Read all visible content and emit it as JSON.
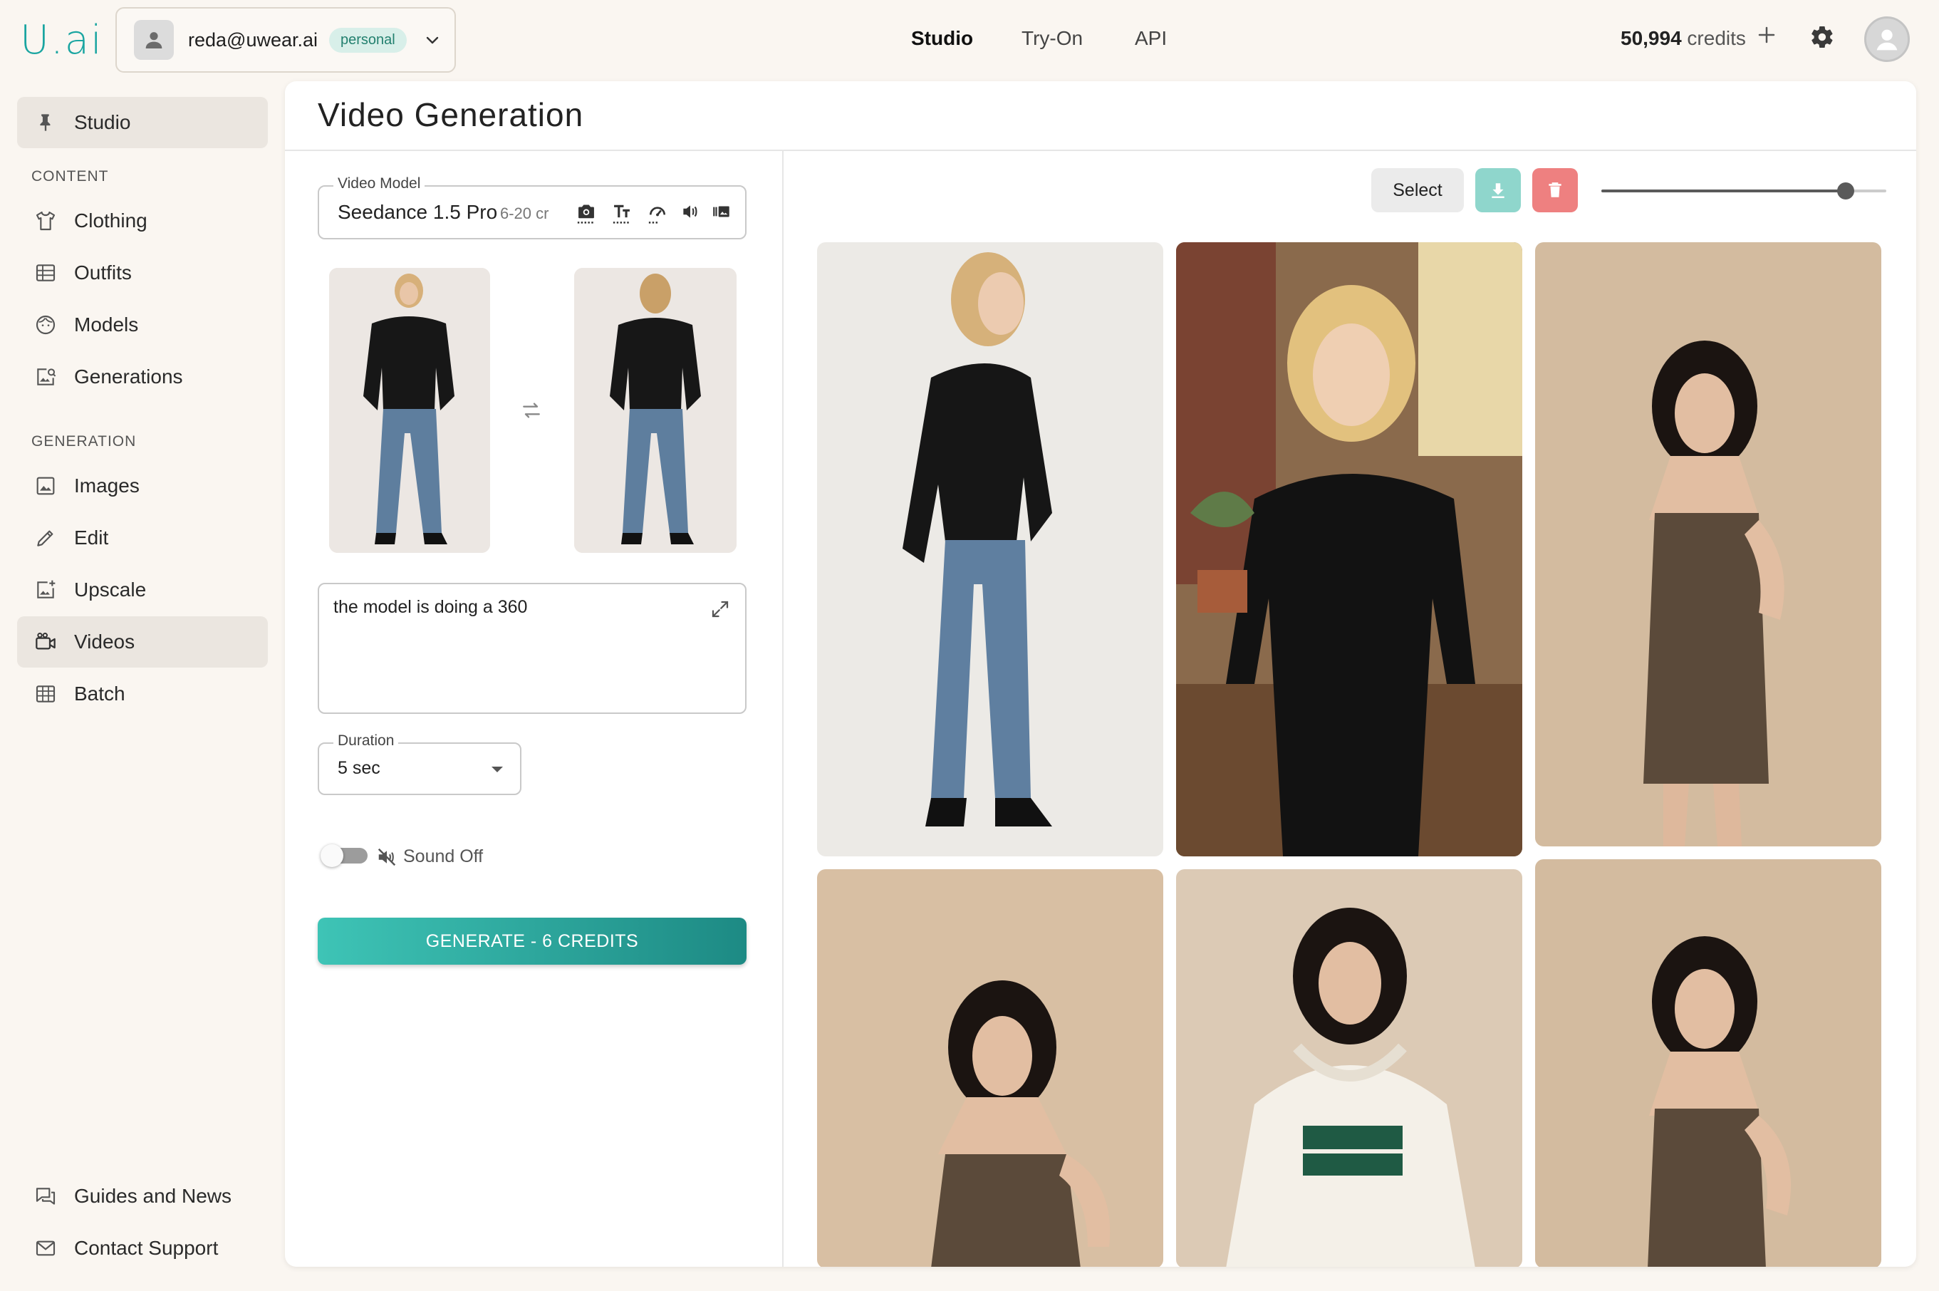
{
  "app": {
    "logo_text": "U.ai",
    "accent": "#1aa5a1"
  },
  "account": {
    "email": "reda@uwear.ai",
    "badge": "personal"
  },
  "nav": {
    "items": [
      "Studio",
      "Try-On",
      "API"
    ],
    "active": "Studio"
  },
  "credits": {
    "amount": "50,994",
    "label": "credits"
  },
  "sidebar": {
    "studio": "Studio",
    "content_header": "CONTENT",
    "content_items": [
      "Clothing",
      "Outfits",
      "Models",
      "Generations"
    ],
    "generation_header": "GENERATION",
    "generation_items": [
      "Images",
      "Edit",
      "Upscale",
      "Videos",
      "Batch"
    ],
    "active_item": "Videos",
    "footer_items": [
      "Guides and News",
      "Contact Support"
    ]
  },
  "page": {
    "title": "Video Generation"
  },
  "video_model": {
    "label": "Video Model",
    "name": "Seedance 1.5 Pro",
    "cost": "6-20 cr",
    "feature_icons": [
      "camera-icon",
      "text-icon",
      "speed-icon",
      "volume-icon",
      "gallery-icon"
    ]
  },
  "prompt": {
    "text": "the model is doing a 360"
  },
  "duration": {
    "label": "Duration",
    "value": "5 sec"
  },
  "sound": {
    "label": "Sound Off",
    "enabled": false
  },
  "generate": {
    "label": "GENERATE - 6 CREDITS",
    "colors": [
      "#3ec4b6",
      "#1d8a84"
    ]
  },
  "toolbar": {
    "select_label": "Select",
    "download_color": "#8fd6cc",
    "delete_color": "#ee8080",
    "zoom_fraction": 0.86
  }
}
